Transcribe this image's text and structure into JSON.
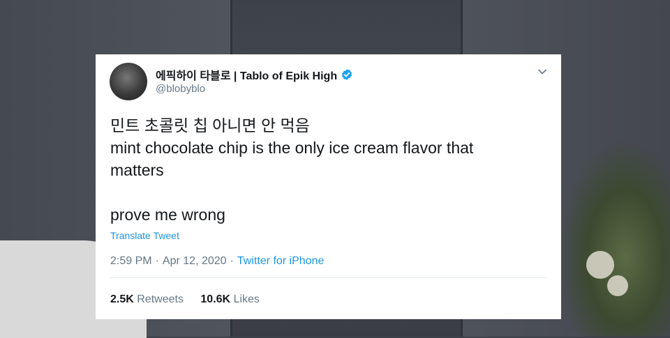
{
  "tweet": {
    "display_name": "에픽하이 타블로 | Tablo of Epik High",
    "handle": "@blobyblo",
    "verified_icon": "verified-badge-icon",
    "body_lines": [
      "민트 초콜릿 칩 아니면 안 먹음",
      "mint chocolate chip is the only ice cream flavor that",
      "matters",
      "",
      "prove me wrong"
    ],
    "translate_label": "Translate Tweet",
    "time": "2:59 PM",
    "date": "Apr 12, 2020",
    "separator": "·",
    "source": "Twitter for iPhone",
    "retweets_count": "2.5K",
    "retweets_label": "Retweets",
    "likes_count": "10.6K",
    "likes_label": "Likes"
  },
  "colors": {
    "accent": "#1b95e0",
    "text": "#14171a",
    "secondary_text": "#657786",
    "verified": "#1da1f2"
  }
}
